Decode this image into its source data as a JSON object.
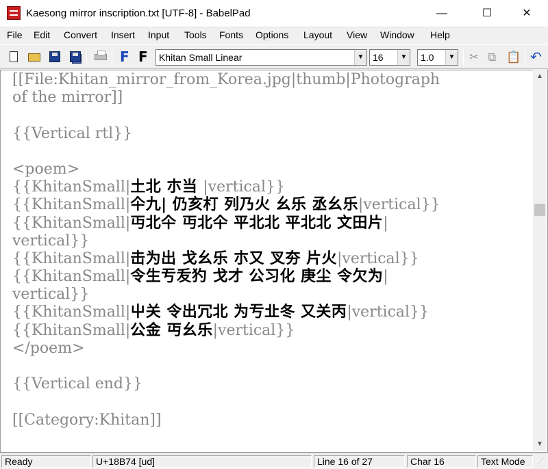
{
  "window": {
    "title": "Kaesong mirror inscription.txt [UTF-8] - BabelPad",
    "minimize_glyph": "—",
    "maximize_glyph": "☐",
    "close_glyph": "✕"
  },
  "menu": [
    {
      "label": "File"
    },
    {
      "label": "Edit"
    },
    {
      "label": "Convert"
    },
    {
      "label": "Insert"
    },
    {
      "label": "Input"
    },
    {
      "label": "Tools"
    },
    {
      "label": "Fonts"
    },
    {
      "label": "Options"
    },
    {
      "label": "Layout"
    },
    {
      "label": "View"
    },
    {
      "label": "Window"
    },
    {
      "label": "Help"
    }
  ],
  "toolbar": {
    "font_name": "Khitan Small Linear",
    "font_size": "16",
    "line_spacing": "1.0",
    "font_bold_glyph": "F",
    "icons": {
      "new": "new-document-icon",
      "open": "open-folder-icon",
      "save": "save-disk-icon",
      "save_all": "save-all-icon",
      "print": "printer-icon",
      "font_select": "font-select-icon",
      "font_apply": "font-apply-icon",
      "cut": "scissors-icon",
      "copy": "copy-icon",
      "paste": "paste-icon",
      "undo": "undo-icon"
    },
    "cut_glyph": "✂",
    "copy_glyph": "⧉",
    "paste_glyph": "📋",
    "undo_glyph": "↶"
  },
  "editor": {
    "lines": [
      [
        {
          "t": "[[File:Khitan_mirror_from_Korea.jpg|thumb|Photograph"
        }
      ],
      [
        {
          "t": "of the mirror]]"
        }
      ],
      [
        {
          "t": ""
        }
      ],
      [
        {
          "t": "{{Vertical rtl}}"
        }
      ],
      [
        {
          "t": ""
        }
      ],
      [
        {
          "t": "<poem>"
        }
      ],
      [
        {
          "t": "{{KhitanSmall|"
        },
        {
          "k": "土北 朩当 "
        },
        {
          "t": "|vertical}}"
        }
      ],
      [
        {
          "t": "{{KhitanSmall|"
        },
        {
          "k": "仐九| 仍亥朾 列乃火 幺乐 丞幺乐"
        },
        {
          "t": "|vertical}}"
        }
      ],
      [
        {
          "t": "{{KhitanSmall|"
        },
        {
          "k": "丏北仐 丏北仐 平北北 平北北 文田片"
        },
        {
          "t": "|"
        }
      ],
      [
        {
          "t": "vertical}}"
        }
      ],
      [
        {
          "t": "{{KhitanSmall|"
        },
        {
          "k": "击为出 戈幺乐 朩又 叉夯 片火"
        },
        {
          "t": "|vertical}}"
        }
      ],
      [
        {
          "t": "{{KhitanSmall|"
        },
        {
          "k": "令生亐叐犳 戈才 公习化 庚尘 令欠为"
        },
        {
          "t": "|"
        }
      ],
      [
        {
          "t": "vertical}}"
        }
      ],
      [
        {
          "t": "{{KhitanSmall|"
        },
        {
          "k": "屮关 令出冗北 为亐㐀冬 又关丙"
        },
        {
          "t": "|vertical}}"
        }
      ],
      [
        {
          "t": "{{KhitanSmall|"
        },
        {
          "k": "公金 丏幺乐"
        },
        {
          "t": "|vertical}}"
        }
      ],
      [
        {
          "t": "</poem>"
        }
      ],
      [
        {
          "t": ""
        }
      ],
      [
        {
          "t": "{{Vertical end}}"
        }
      ],
      [
        {
          "t": ""
        }
      ],
      [
        {
          "t": "[[Category:Khitan]]"
        }
      ]
    ]
  },
  "status": {
    "ready": "Ready",
    "codepoint": "U+18B74 [ud]",
    "line": "Line 16 of 27",
    "char": "Char 16",
    "mode": "Text Mode"
  },
  "scrollbar": {
    "up_glyph": "▲",
    "down_glyph": "▼"
  },
  "resize_glyph": "⋰"
}
